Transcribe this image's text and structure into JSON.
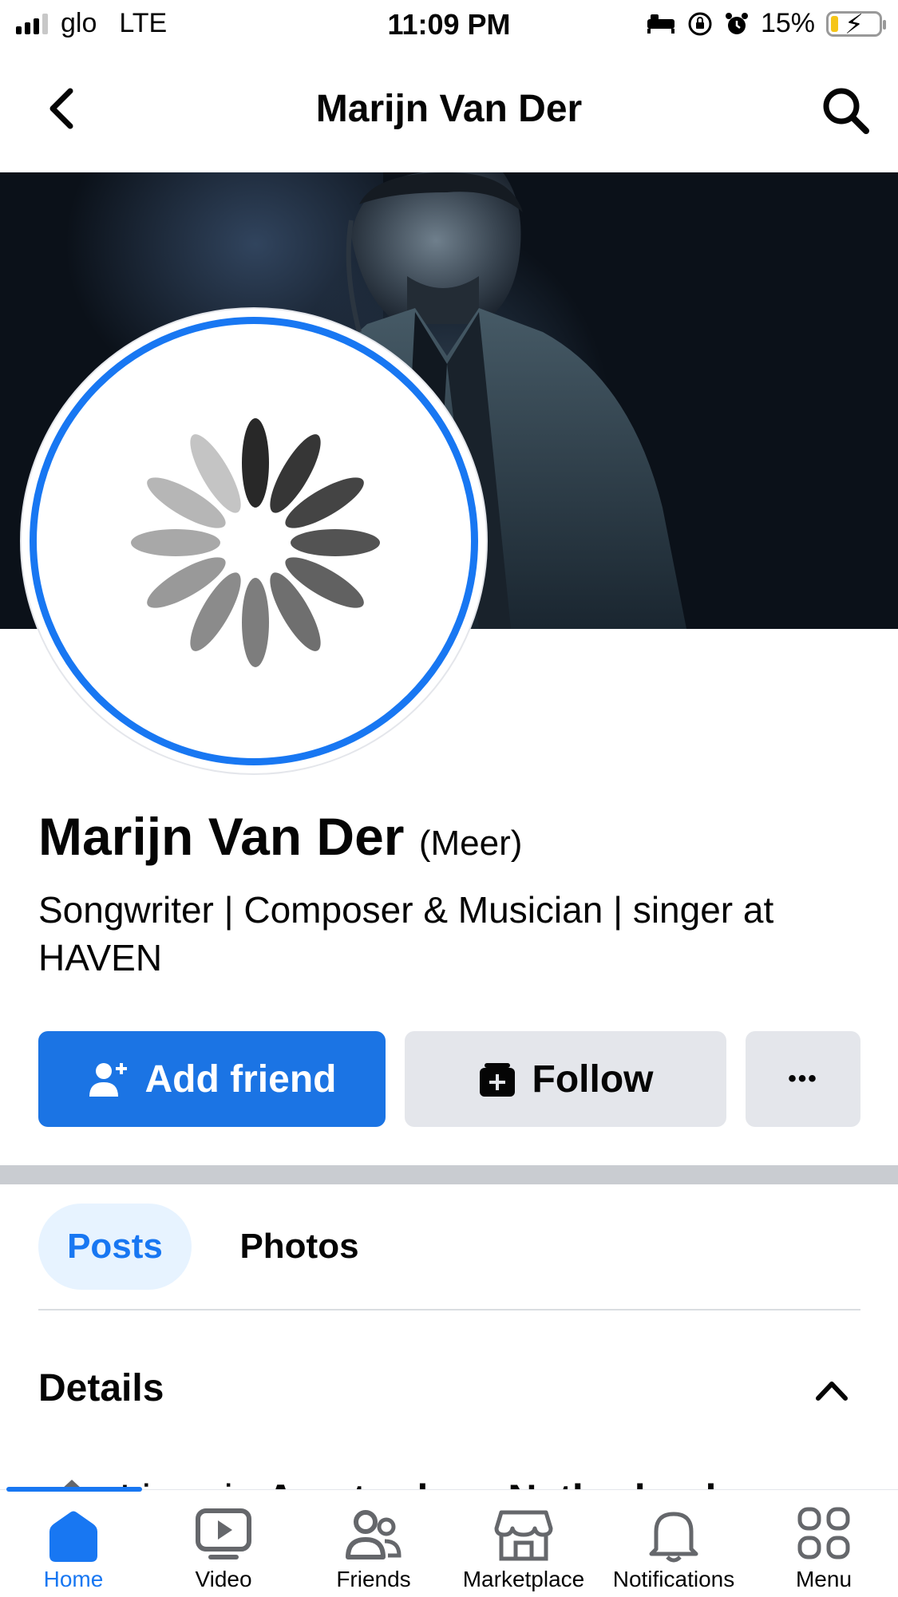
{
  "status_bar": {
    "carrier": "glo",
    "network": "LTE",
    "time": "11:09 PM",
    "battery_percent": "15%",
    "battery_level": 0.15,
    "battery_fill_color": "#f5c518"
  },
  "header": {
    "title": "Marijn Van Der",
    "back_icon": "chevron-left-icon",
    "search_icon": "search-icon"
  },
  "profile": {
    "name": "Marijn Van Der",
    "alternate_name": "(Meer)",
    "bio": "Songwriter | Composer & Musician | singer at HAVEN",
    "avatar_ring_color": "#1877f2"
  },
  "actions": {
    "add_friend_label": "Add friend",
    "follow_label": "Follow",
    "more_label": "•••",
    "add_friend_color": "#1b74e4"
  },
  "tabs": [
    {
      "label": "Posts",
      "active": true
    },
    {
      "label": "Photos",
      "active": false
    }
  ],
  "details": {
    "title": "Details",
    "lives_in_prefix": "Lives in ",
    "lives_in_place": "Amsterdam, Netherlands"
  },
  "bottom_nav": [
    {
      "label": "Home",
      "icon": "home-icon",
      "active": true
    },
    {
      "label": "Video",
      "icon": "video-icon",
      "active": false
    },
    {
      "label": "Friends",
      "icon": "friends-icon",
      "active": false
    },
    {
      "label": "Marketplace",
      "icon": "marketplace-icon",
      "active": false
    },
    {
      "label": "Notifications",
      "icon": "bell-icon",
      "active": false
    },
    {
      "label": "Menu",
      "icon": "menu-grid-icon",
      "active": false
    }
  ]
}
